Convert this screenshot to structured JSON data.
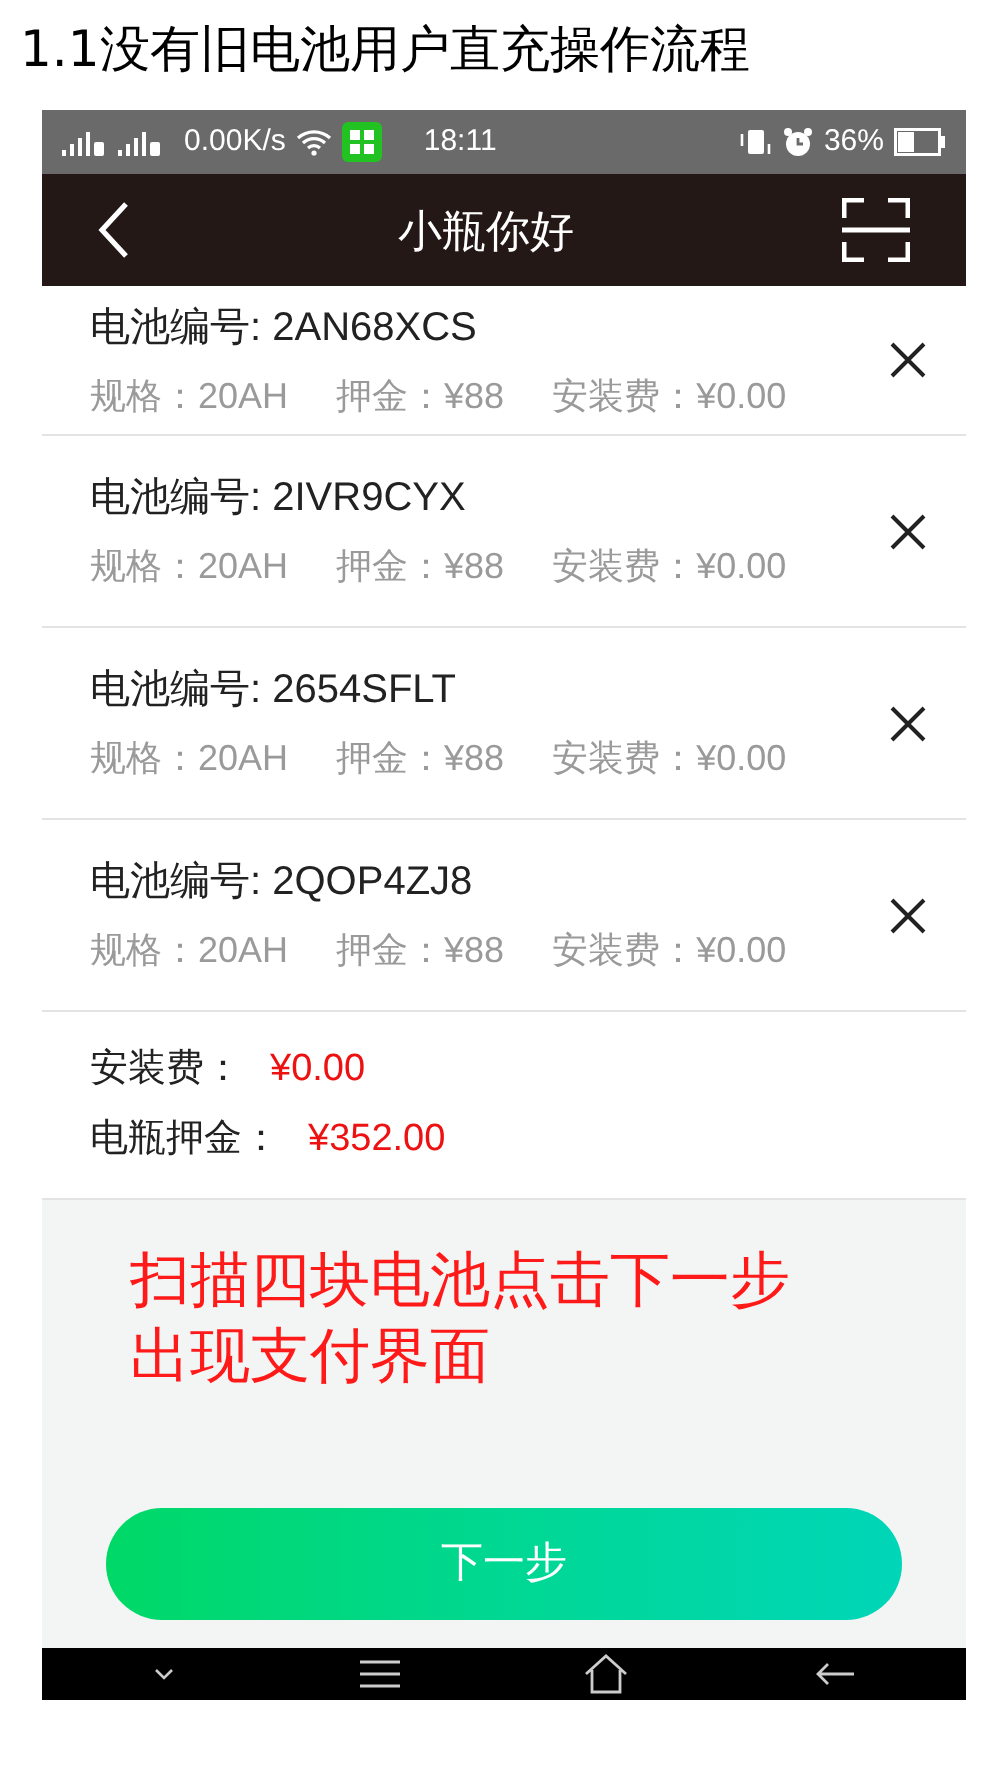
{
  "heading": "1.1没有旧电池用户直充操作流程",
  "status_bar": {
    "speed": "0.00K/s",
    "time": "18:11",
    "battery": "36%"
  },
  "nav": {
    "title": "小瓶你好"
  },
  "batteries": [
    {
      "number": "电池编号: 2AN68XCS",
      "spec": "规格：20AH",
      "deposit": "押金：¥88",
      "fee": "安装费：¥0.00"
    },
    {
      "number": "电池编号: 2IVR9CYX",
      "spec": "规格：20AH",
      "deposit": "押金：¥88",
      "fee": "安装费：¥0.00"
    },
    {
      "number": "电池编号: 2654SFLT",
      "spec": "规格：20AH",
      "deposit": "押金：¥88",
      "fee": "安装费：¥0.00"
    },
    {
      "number": "电池编号: 2QOP4ZJ8",
      "spec": "规格：20AH",
      "deposit": "押金：¥88",
      "fee": "安装费：¥0.00"
    }
  ],
  "summary": [
    {
      "label": "安装费：",
      "value": "¥0.00"
    },
    {
      "label": "电瓶押金：",
      "value": "¥352.00"
    }
  ],
  "annotation": [
    "扫描四块电池点击下一步",
    "出现支付界面"
  ],
  "next_button": "下一步"
}
